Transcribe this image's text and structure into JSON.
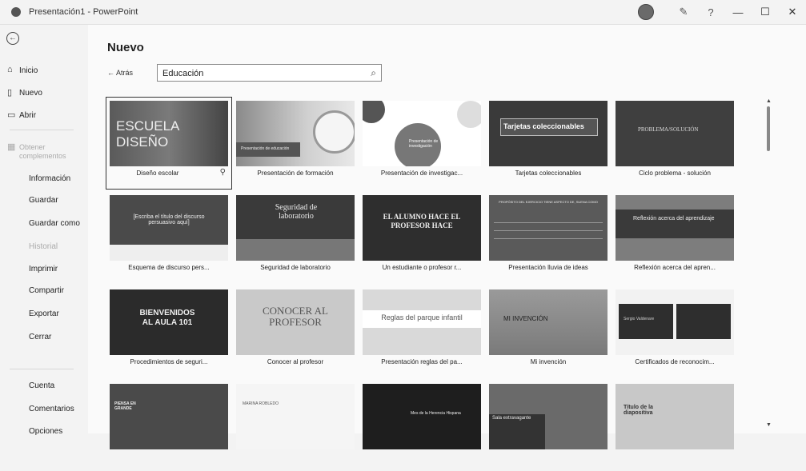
{
  "window": {
    "title": "Presentación1 - PowerPoint",
    "icons": [
      "powerpoint-logo-icon",
      "avatar",
      "pen-icon",
      "help-icon",
      "minimize-icon",
      "maximize-icon",
      "close-icon"
    ],
    "help_glyph": "?",
    "min_glyph": "—",
    "max_glyph": "☐",
    "close_glyph": "✕"
  },
  "sidebar": {
    "back_glyph": "←",
    "inicio": "Inicio",
    "nuevo": "Nuevo",
    "abrir": "Abrir",
    "obtener": "Obtener complementos",
    "informacion": "Información",
    "guardar": "Guardar",
    "guardar_como": "Guardar como",
    "historial": "Historial",
    "imprimir": "Imprimir",
    "compartir": "Compartir",
    "exportar": "Exportar",
    "cerrar": "Cerrar",
    "cuenta": "Cuenta",
    "comentarios": "Comentarios",
    "opciones": "Opciones"
  },
  "main": {
    "title": "Nuevo",
    "back_label": "← Atrás",
    "search_value": "Educación",
    "search_icon_glyph": "⌕"
  },
  "templates": [
    {
      "label": "Diseño escolar",
      "thumb_text": "ESCUELA DISEÑO"
    },
    {
      "label": "Presentación de formación",
      "thumb_text": "Presentación de educación"
    },
    {
      "label": "Presentación de investigac...",
      "thumb_text": "Presentación de investigación"
    },
    {
      "label": "Tarjetas coleccionables",
      "thumb_text": "Tarjetas coleccionables"
    },
    {
      "label": "Ciclo problema - solución",
      "thumb_text": "PROBLEMA/SOLUCIÓN"
    },
    {
      "label": "Esquema de discurso pers...",
      "thumb_text": "[Escriba el título del discurso persuasivo aquí]"
    },
    {
      "label": "Seguridad de laboratorio",
      "thumb_text": "Seguridad de laboratorio"
    },
    {
      "label": "Un estudiante o profesor r...",
      "thumb_text": "EL ALUMNO HACE EL PROFESOR HACE"
    },
    {
      "label": "Presentación lluvia de ideas",
      "thumb_text": "PROPÓSITO DEL EJERCICIO TIENE ASPECTO DE, SUENA COMO"
    },
    {
      "label": "Reflexión acerca del apren...",
      "thumb_text": "Reflexión acerca del aprendizaje"
    },
    {
      "label": "Procedimientos de seguri...",
      "thumb_text": "BIENVENIDOS AL AULA 101"
    },
    {
      "label": "Conocer al profesor",
      "thumb_text": "CONOCER AL PROFESOR"
    },
    {
      "label": "Presentación reglas del pa...",
      "thumb_text": "Reglas del parque infantil"
    },
    {
      "label": "Mi invención",
      "thumb_text": "MI INVENCIÓN"
    },
    {
      "label": "Certificados de reconocim...",
      "thumb_text": "Sergio Valdenare"
    },
    {
      "label": "",
      "thumb_text": "PIENSA EN GRANDE"
    },
    {
      "label": "",
      "thumb_text": "MARINA ROBLEDO"
    },
    {
      "label": "",
      "thumb_text": "Mes de la Herencia Hispana"
    },
    {
      "label": "",
      "thumb_text": "Sala extravagante"
    },
    {
      "label": "",
      "thumb_text": "Título de la diapositiva"
    }
  ]
}
